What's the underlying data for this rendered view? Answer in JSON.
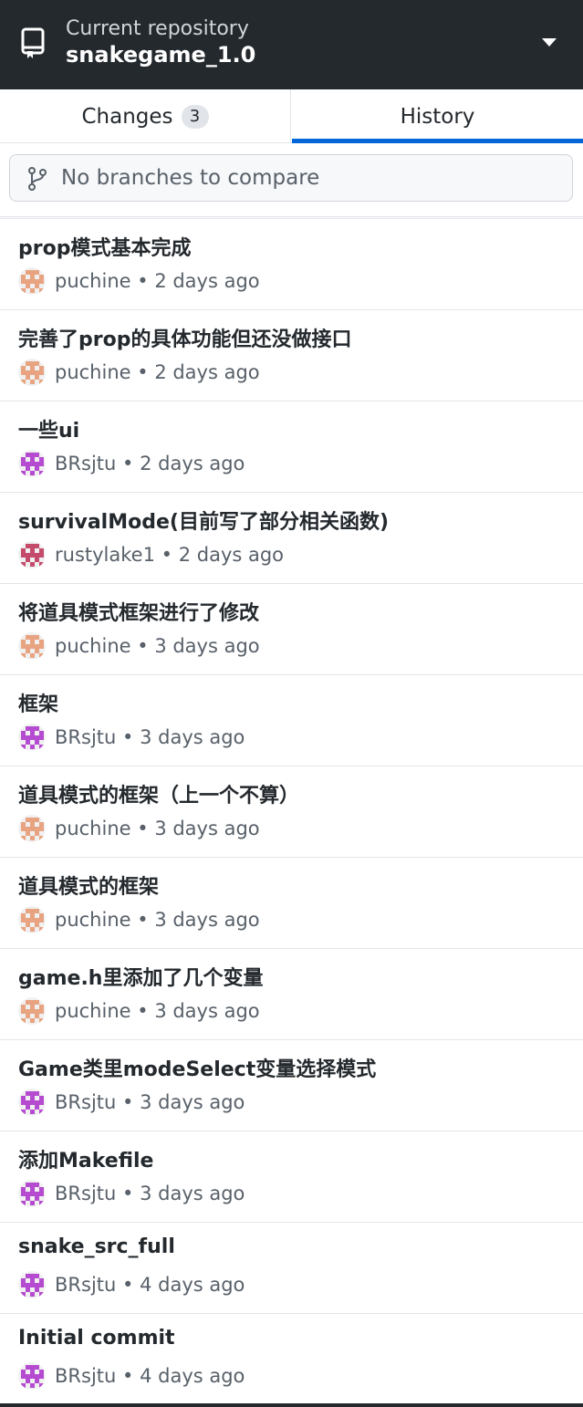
{
  "header": {
    "label": "Current repository",
    "repo_name": "snakegame_1.0",
    "repo_icon": "repo-icon",
    "dropdown_icon": "caret-down-icon"
  },
  "tabs": {
    "changes_label": "Changes",
    "changes_count": "3",
    "history_label": "History",
    "active": "History",
    "accent": "#0366d6"
  },
  "compare": {
    "icon": "git-branch-icon",
    "text": "No branches to compare"
  },
  "commits": [
    {
      "title": "prop模式基本完成",
      "author": "puchine",
      "time": "2 days ago",
      "avatar_color": "#e8a380"
    },
    {
      "title": "完善了prop的具体功能但还没做接口",
      "author": "puchine",
      "time": "2 days ago",
      "avatar_color": "#e8a380"
    },
    {
      "title": "一些ui",
      "author": "BRsjtu",
      "time": "2 days ago",
      "avatar_color": "#b54bd0"
    },
    {
      "title": "survivalMode(目前写了部分相关函数)",
      "author": "rustylake1",
      "time": "2 days ago",
      "avatar_color": "#c44b6b"
    },
    {
      "title": "将道具模式框架进行了修改",
      "author": "puchine",
      "time": "3 days ago",
      "avatar_color": "#e8a380"
    },
    {
      "title": "框架",
      "author": "BRsjtu",
      "time": "3 days ago",
      "avatar_color": "#b54bd0"
    },
    {
      "title": "道具模式的框架（上一个不算）",
      "author": "puchine",
      "time": "3 days ago",
      "avatar_color": "#e8a380"
    },
    {
      "title": "道具模式的框架",
      "author": "puchine",
      "time": "3 days ago",
      "avatar_color": "#e8a380"
    },
    {
      "title": "game.h里添加了几个变量",
      "author": "puchine",
      "time": "3 days ago",
      "avatar_color": "#e8a380"
    },
    {
      "title": "Game类里modeSelect变量选择模式",
      "author": "BRsjtu",
      "time": "3 days ago",
      "avatar_color": "#b54bd0"
    },
    {
      "title": "添加Makefile",
      "author": "BRsjtu",
      "time": "3 days ago",
      "avatar_color": "#b54bd0"
    },
    {
      "title": "snake_src_full",
      "author": "BRsjtu",
      "time": "4 days ago",
      "avatar_color": "#b54bd0"
    },
    {
      "title": "Initial commit",
      "author": "BRsjtu",
      "time": "4 days ago",
      "avatar_color": "#b54bd0"
    }
  ]
}
